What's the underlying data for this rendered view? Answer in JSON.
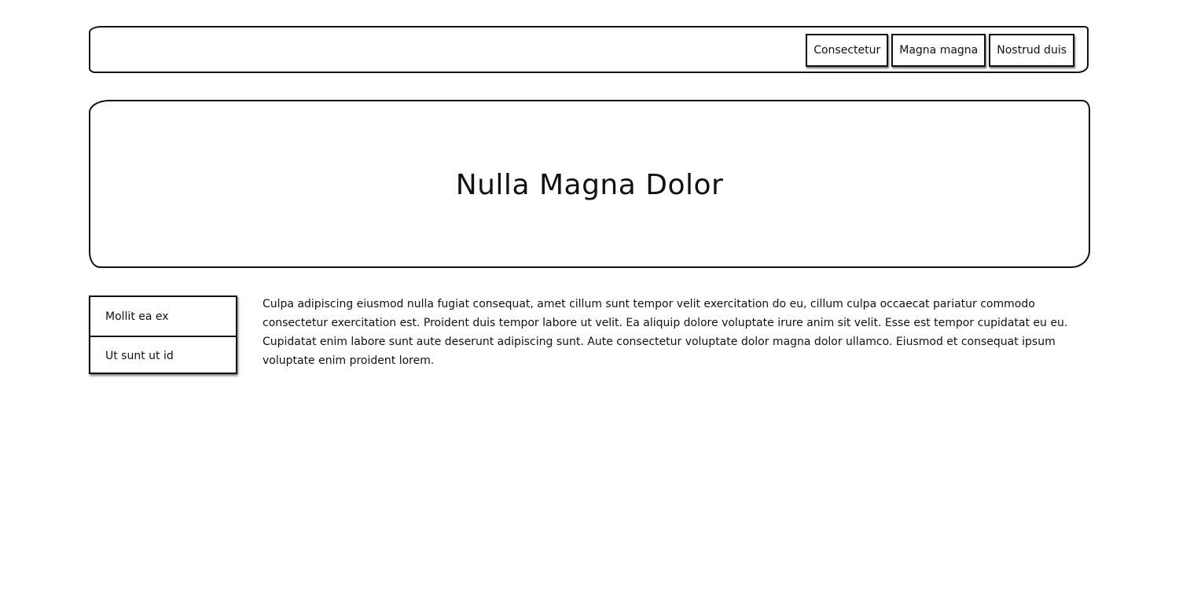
{
  "nav": {
    "items": [
      {
        "label": "Consectetur"
      },
      {
        "label": "Magna magna"
      },
      {
        "label": "Nostrud duis"
      }
    ]
  },
  "hero": {
    "title": "Nulla Magna Dolor"
  },
  "sidebar": {
    "items": [
      {
        "label": "Mollit ea ex"
      },
      {
        "label": "Ut sunt ut id"
      }
    ]
  },
  "main": {
    "paragraph": "Culpa adipiscing eiusmod nulla fugiat consequat, amet cillum sunt tempor velit exercitation do eu, cillum culpa occaecat pariatur commodo consectetur exercitation est. Proident duis tempor labore ut velit. Ea aliquip dolore voluptate irure anim sit velit. Esse est tempor cupidatat eu eu. Cupidatat enim labore sunt aute deserunt adipiscing sunt. Aute consectetur voluptate dolor magna dolor ullamco. Eiusmod et consequat ipsum voluptate enim proident lorem."
  }
}
